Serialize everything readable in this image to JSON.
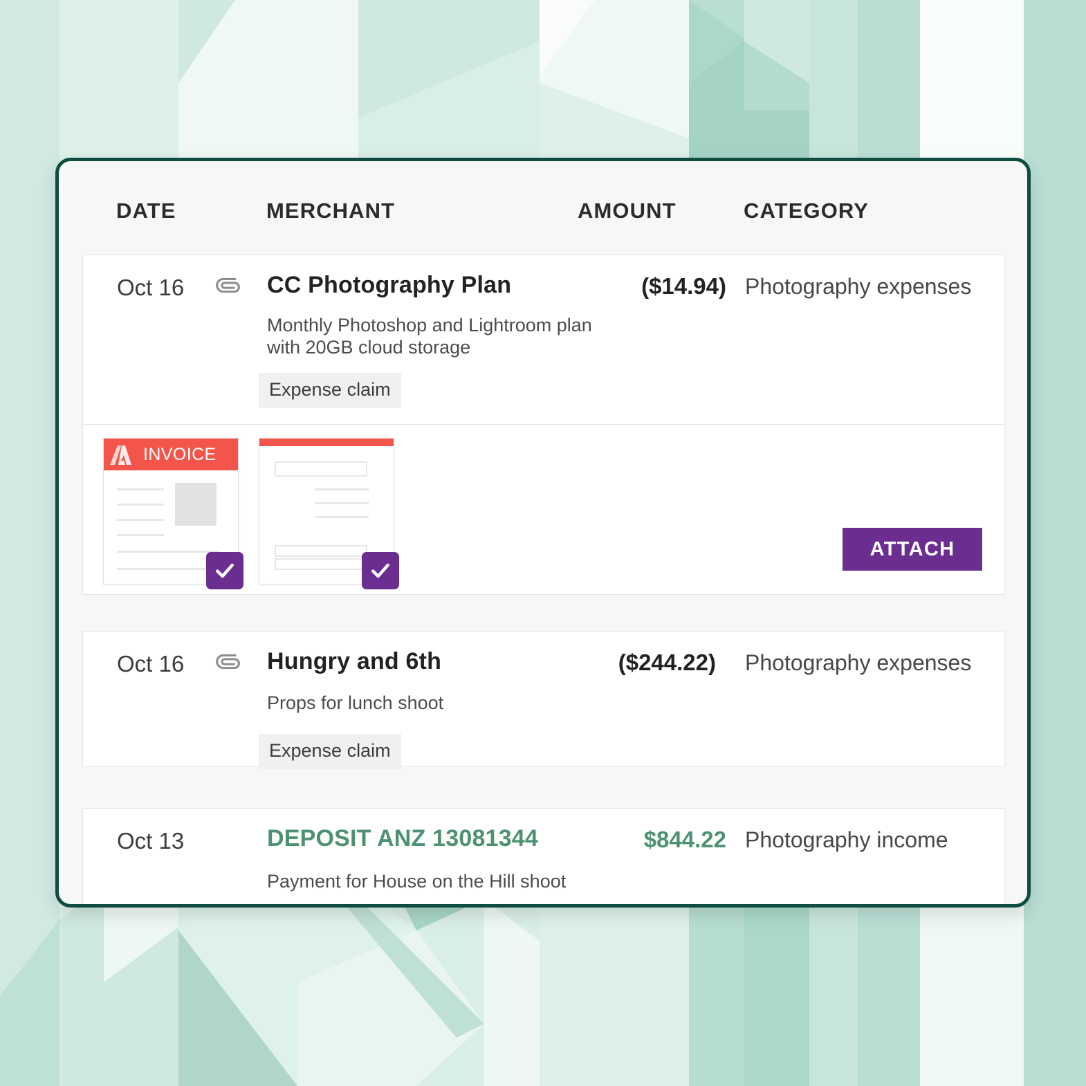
{
  "theme": {
    "card_border": "#0e4d40",
    "card_bg": "#f7f7f7",
    "row_bg": "#ffffff",
    "income_green": "#4d9173",
    "accent_purple": "#6b2d8f",
    "invoice_red": "#f4554a",
    "tag_bg": "#f0f0f0",
    "bg_mint": "#e3f3ee"
  },
  "table": {
    "columns": [
      {
        "key": "date",
        "label": "DATE"
      },
      {
        "key": "merchant",
        "label": "MERCHANT"
      },
      {
        "key": "amount",
        "label": "AMOUNT"
      },
      {
        "key": "category",
        "label": "CATEGORY"
      }
    ],
    "rows": [
      {
        "date": "Oct 16",
        "attachment_icon": "paperclip-icon",
        "merchant": "CC Photography Plan",
        "description": "Monthly Photoshop and Lightroom plan\nwith 20GB cloud storage",
        "tag": "Expense claim",
        "amount": "($14.94)",
        "category": "Photography expenses",
        "type": "expense"
      },
      {
        "date": "Oct 16",
        "attachment_icon": "paperclip-icon",
        "merchant": "Hungry and 6th",
        "description": "Props for lunch shoot",
        "tag": "Expense claim",
        "amount": "($244.22)",
        "category": "Photography expenses",
        "type": "expense"
      },
      {
        "date": "Oct 13",
        "merchant": "DEPOSIT ANZ 13081344",
        "description": "Payment for House on the Hill shoot",
        "amount": "$844.22",
        "category": "Photography income",
        "type": "income"
      }
    ]
  },
  "attachments": {
    "items": [
      {
        "kind": "invoice",
        "brand_icon": "adobe-logo-icon",
        "label": "INVOICE",
        "selected": true,
        "check_icon": "check-icon"
      },
      {
        "kind": "document",
        "label": "",
        "selected": true,
        "check_icon": "check-icon"
      }
    ],
    "attach_button": "ATTACH"
  }
}
